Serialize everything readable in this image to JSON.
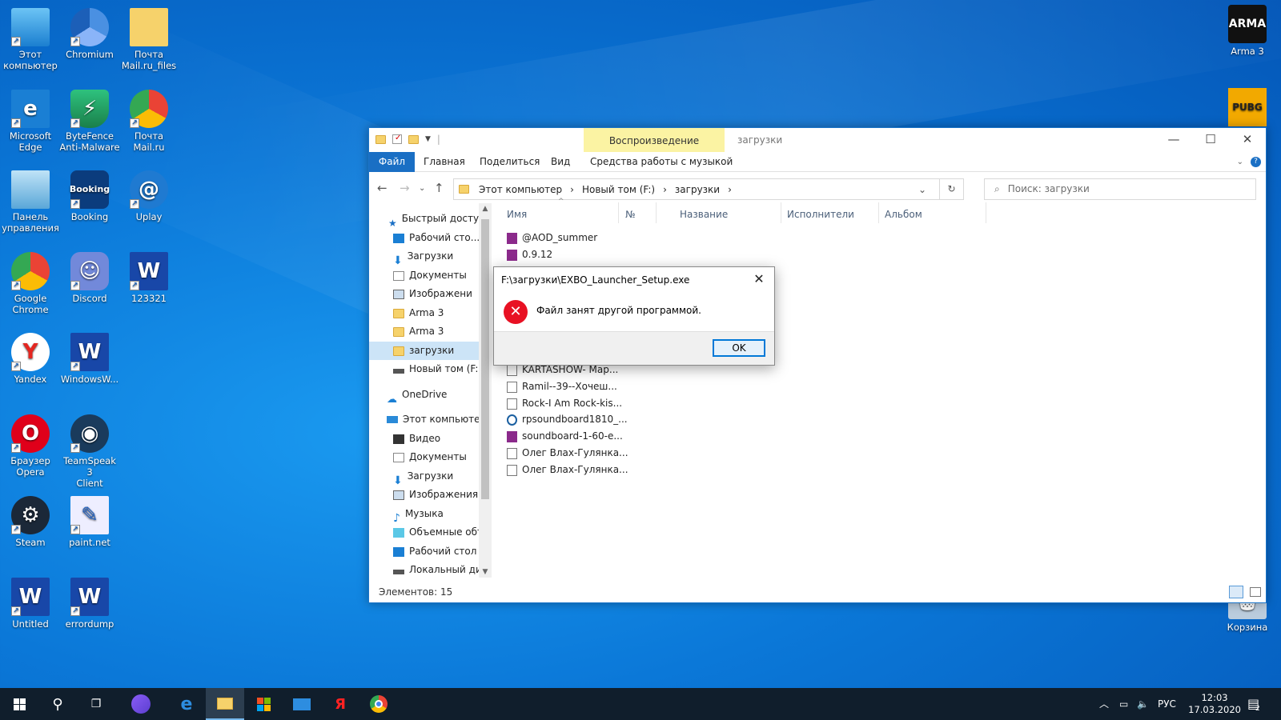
{
  "desktop": {
    "icons": [
      {
        "label": "Этот\nкомпьютер",
        "icon": "computer-icon"
      },
      {
        "label": "Chromium",
        "icon": "chromium-icon"
      },
      {
        "label": "Почта\nMail.ru_files",
        "icon": "folder-icon"
      },
      {
        "label": "Microsoft\nEdge",
        "icon": "edge-icon"
      },
      {
        "label": "ByteFence\nAnti-Malware",
        "icon": "bytefence-icon"
      },
      {
        "label": "Почта\nMail.ru",
        "icon": "chrome-icon"
      },
      {
        "label": "Панель\nуправления",
        "icon": "control-panel-icon"
      },
      {
        "label": "Booking",
        "icon": "booking-icon"
      },
      {
        "label": "Uplay",
        "icon": "uplay-icon"
      },
      {
        "label": "Google\nChrome",
        "icon": "chrome-icon"
      },
      {
        "label": "Discord",
        "icon": "discord-icon"
      },
      {
        "label": "123321",
        "icon": "word-icon"
      },
      {
        "label": "Yandex",
        "icon": "yandex-icon"
      },
      {
        "label": "WindowsW...",
        "icon": "word-icon"
      },
      {
        "label": "Браузер\nOpera",
        "icon": "opera-icon"
      },
      {
        "label": "TeamSpeak 3\nClient",
        "icon": "teamspeak-icon"
      },
      {
        "label": "Steam",
        "icon": "steam-icon"
      },
      {
        "label": "paint.net",
        "icon": "paintnet-icon"
      },
      {
        "label": "Untitled",
        "icon": "word-icon"
      },
      {
        "label": "errordump",
        "icon": "word-icon"
      },
      {
        "label": "Arma 3",
        "icon": "arma-icon"
      },
      {
        "label": "Корзина",
        "icon": "recycle-bin-icon"
      }
    ],
    "booking_logo": "Booking",
    "arma_logo": "ARMA",
    "pubg_logo": "PUBG"
  },
  "explorer": {
    "context_tab": "Воспроизведение",
    "window_title": "загрузки",
    "ribbon_tabs": [
      "Файл",
      "Главная",
      "Поделиться",
      "Вид",
      "Средства работы с музыкой"
    ],
    "breadcrumb": [
      "Этот компьютер",
      "Новый том (F:)",
      "загрузки"
    ],
    "search_placeholder": "Поиск: загрузки",
    "nav": {
      "quick_access": "Быстрый доступ",
      "items": [
        "Рабочий сто...",
        "Загрузки",
        "Документы",
        "Изображени",
        "Arma 3",
        "Arma 3",
        "загрузки",
        "Новый том (F:)"
      ],
      "onedrive": "OneDrive",
      "this_pc": "Этот компьютер",
      "pc_items": [
        "Видео",
        "Документы",
        "Загрузки",
        "Изображения",
        "Музыка",
        "Объемные объ",
        "Рабочий стол",
        "Локальный дис"
      ]
    },
    "columns": [
      "Имя",
      "№",
      "Название",
      "Исполнители",
      "Альбом"
    ],
    "files": [
      "@AOD_summer",
      "0.9.12",
      "KARTASHOW- Мар...",
      "Ramil--39--Хочеш...",
      "Rock-I Am Rock-kis...",
      "rpsoundboard1810_...",
      "soundboard-1-60-e...",
      "Олег Влах-Гулянка...",
      "Олег Влах-Гулянка..."
    ],
    "status": "Элементов: 15"
  },
  "dialog": {
    "title": "F:\\загрузки\\EXBO_Launcher_Setup.exe",
    "message": "Файл занят другой программой.",
    "ok": "OK"
  },
  "taskbar": {
    "lang": "РУС",
    "time": "12:03",
    "date": "17.03.2020",
    "notifications": "2"
  }
}
